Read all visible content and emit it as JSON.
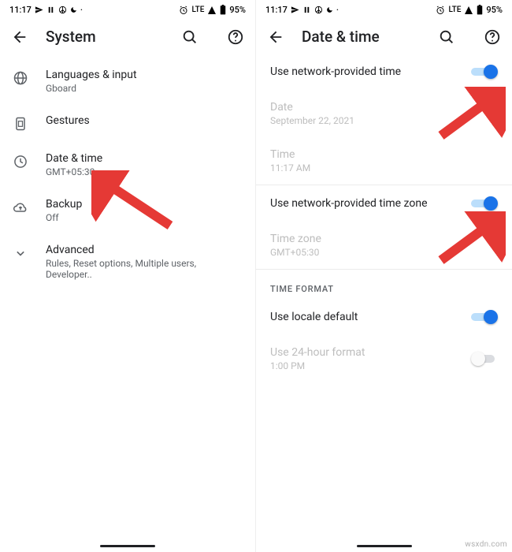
{
  "status": {
    "time": "11:17",
    "network": "LTE",
    "battery": "95%"
  },
  "left": {
    "title": "System",
    "items": [
      {
        "title": "Languages & input",
        "sub": "Gboard"
      },
      {
        "title": "Gestures",
        "sub": ""
      },
      {
        "title": "Date & time",
        "sub": "GMT+05:30"
      },
      {
        "title": "Backup",
        "sub": "Off"
      },
      {
        "title": "Advanced",
        "sub": "Rules, Reset options, Multiple users, Developer.."
      }
    ]
  },
  "right": {
    "title": "Date & time",
    "rows": {
      "net_time": "Use network-provided time",
      "date_label": "Date",
      "date_value": "September 22, 2021",
      "time_label": "Time",
      "time_value": "11:17 AM",
      "net_tz": "Use network-provided time zone",
      "tz_label": "Time zone",
      "tz_value": "GMT+05:30",
      "section": "TIME FORMAT",
      "locale": "Use locale default",
      "use24": "Use 24-hour format",
      "use24_sub": "1:00 PM"
    }
  },
  "watermark": "wsxdn.com"
}
